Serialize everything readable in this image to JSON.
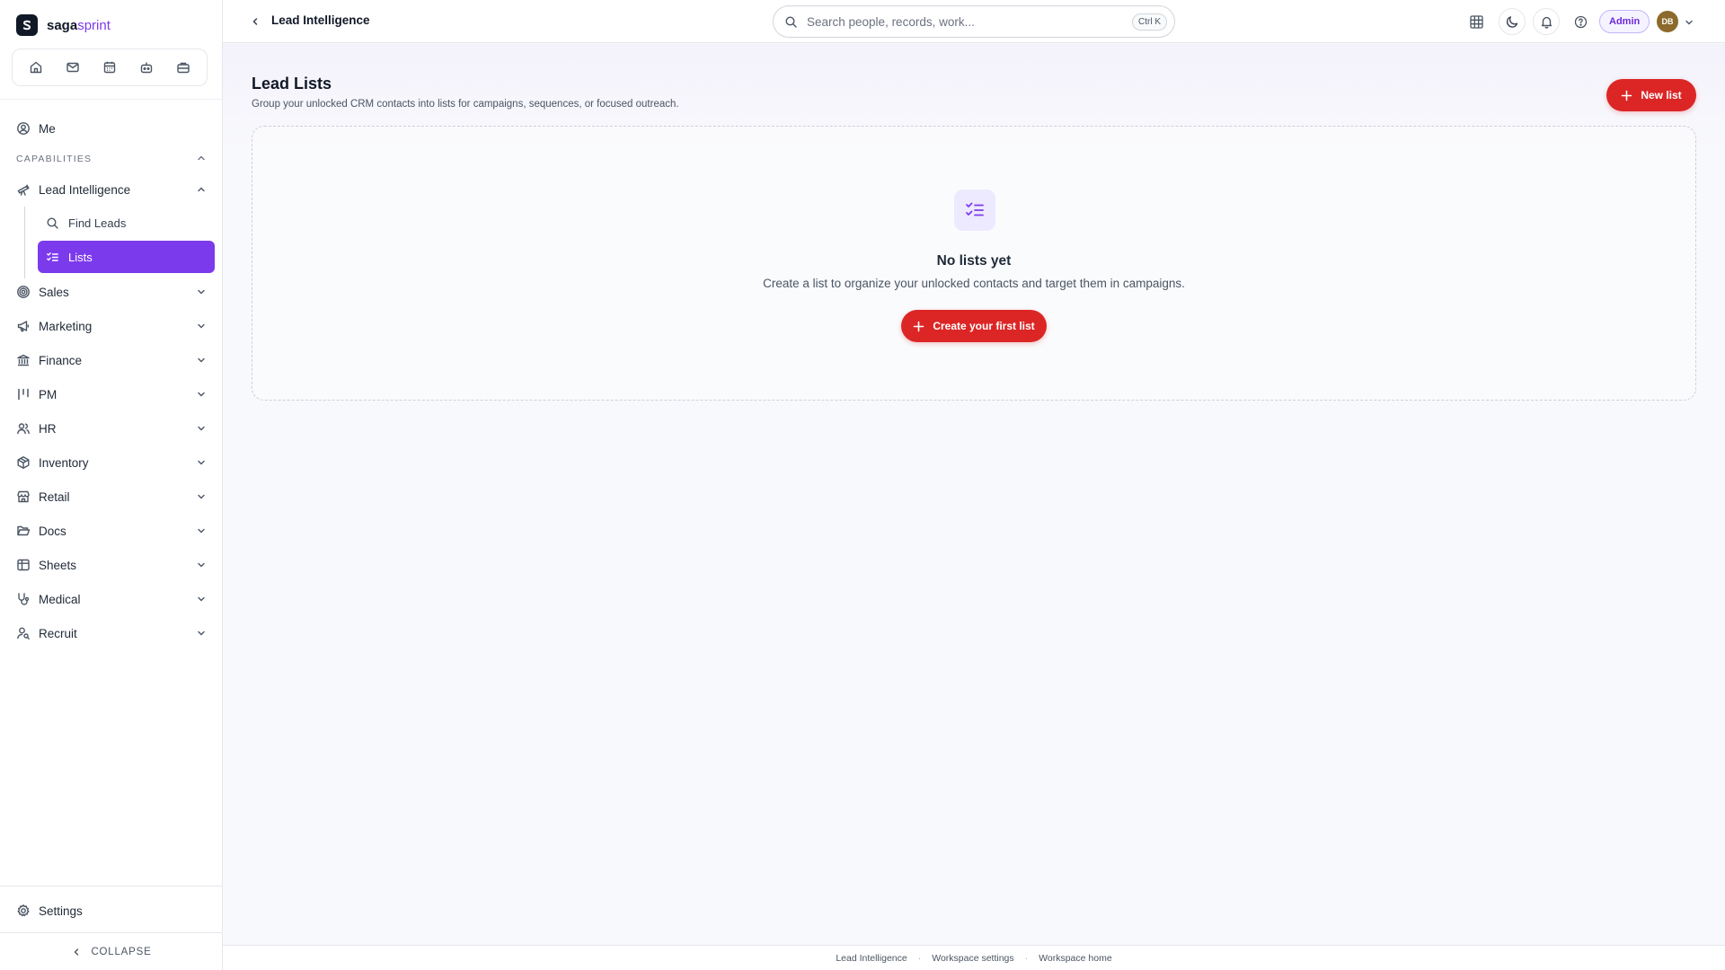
{
  "brand": {
    "name_main": "saga",
    "name_accent": "sprint",
    "logo_letter": "S"
  },
  "quick_bar": {
    "icons": [
      "home-icon",
      "mail-icon",
      "calendar-icon",
      "bot-icon",
      "briefcase-icon"
    ]
  },
  "sidebar": {
    "me": "Me",
    "section_label": "CAPABILITIES",
    "lead_intelligence": {
      "label": "Lead Intelligence",
      "children": [
        {
          "label": "Find Leads",
          "icon": "search-icon"
        },
        {
          "label": "Lists",
          "icon": "list-checks-icon",
          "active": true
        }
      ]
    },
    "items": [
      {
        "label": "Sales",
        "icon": "target-icon"
      },
      {
        "label": "Marketing",
        "icon": "megaphone-icon"
      },
      {
        "label": "Finance",
        "icon": "bank-icon"
      },
      {
        "label": "PM",
        "icon": "kanban-icon"
      },
      {
        "label": "HR",
        "icon": "users-icon"
      },
      {
        "label": "Inventory",
        "icon": "package-icon"
      },
      {
        "label": "Retail",
        "icon": "store-icon"
      },
      {
        "label": "Docs",
        "icon": "folder-icon"
      },
      {
        "label": "Sheets",
        "icon": "table-icon"
      },
      {
        "label": "Medical",
        "icon": "stethoscope-icon"
      },
      {
        "label": "Recruit",
        "icon": "user-search-icon"
      }
    ],
    "settings": "Settings",
    "collapse": "COLLAPSE"
  },
  "topbar": {
    "breadcrumb": "Lead Intelligence",
    "search_placeholder": "Search people, records, work...",
    "search_shortcut": "Ctrl K",
    "role_badge": "Admin",
    "avatar_initials": "DB"
  },
  "main": {
    "title": "Lead Lists",
    "subtitle": "Group your unlocked CRM contacts into lists for campaigns, sequences, or focused outreach.",
    "new_button": "New list",
    "empty": {
      "title": "No lists yet",
      "description": "Create a list to organize your unlocked contacts and target them in campaigns.",
      "button": "Create your first list"
    }
  },
  "footer": {
    "links": [
      "Lead Intelligence",
      "Workspace settings",
      "Workspace home"
    ],
    "separator": "·"
  },
  "colors": {
    "accent": "#7c3aed",
    "primary_action": "#dc2626",
    "avatar_bg": "#8b6a2b"
  }
}
